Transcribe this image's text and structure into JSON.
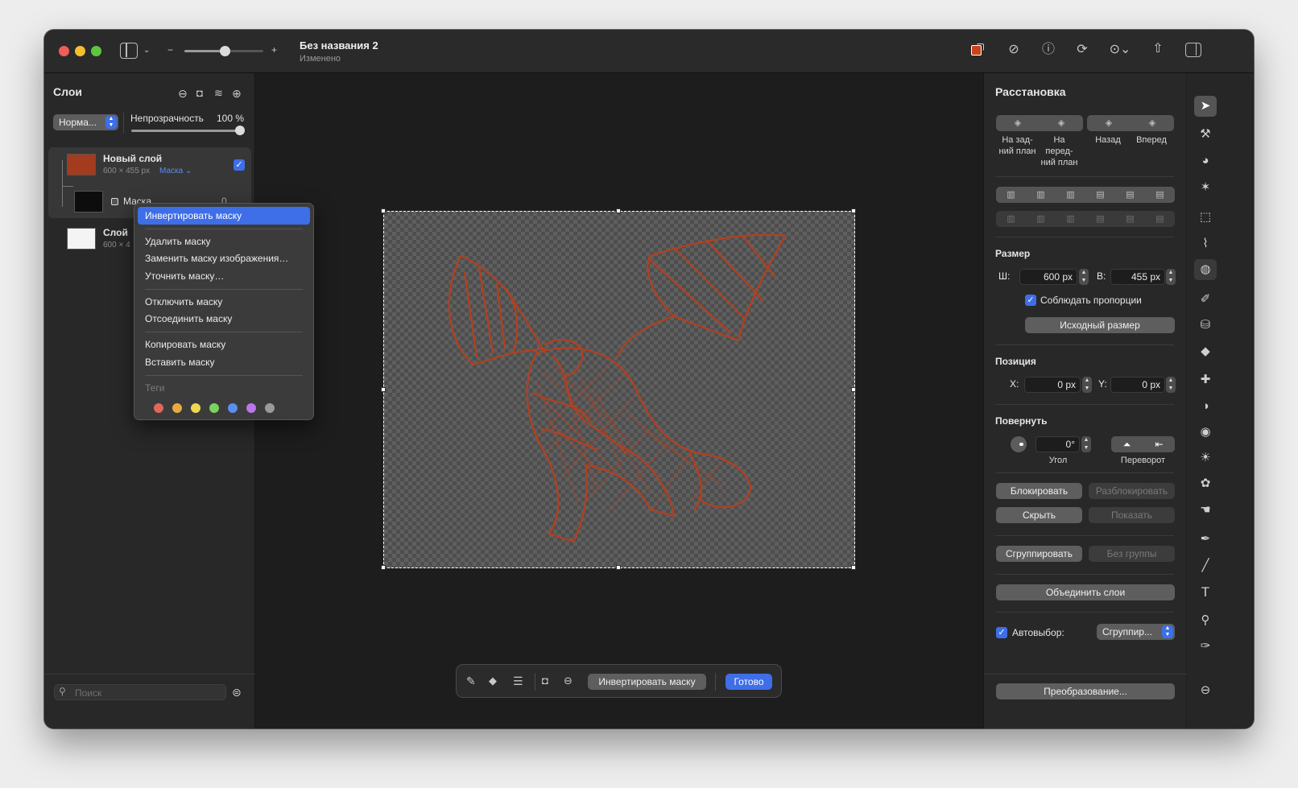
{
  "window": {
    "title": "Без названия 2",
    "subtitle": "Изменено"
  },
  "layers_panel": {
    "title": "Слои",
    "blend_mode": "Норма...",
    "opacity_label": "Непрозрачность",
    "opacity_value": "100 %",
    "opacity_fraction": 1.0,
    "layers": [
      {
        "name": "Новый слой",
        "size": "600 × 455 px",
        "tag": "Маска ⌄",
        "color": "#a33b1e"
      },
      {
        "name": "Маска",
        "extra": "0"
      },
      {
        "name": "Слой",
        "size": "600 × 4"
      }
    ],
    "search_placeholder": "Поиск"
  },
  "context_menu": {
    "items": [
      "Инвертировать маску",
      "Удалить маску",
      "Заменить маску изображения…",
      "Уточнить маску…",
      "Отключить маску",
      "Отсоединить маску",
      "Копировать маску",
      "Вставить маску"
    ],
    "tags_label": "Теги",
    "tag_colors": [
      "#e2665c",
      "#eaa93f",
      "#efd84d",
      "#7ad35c",
      "#5a8ff0",
      "#b877e8",
      "#9a9a9a"
    ]
  },
  "arrange_panel": {
    "title": "Расстановка",
    "order_buttons": [
      "На зад-\nний план",
      "На\nперед-\nний план",
      "Назад",
      "Вперед"
    ],
    "size_title": "Размер",
    "width_label": "Ш:",
    "width_value": "600 px",
    "height_label": "В:",
    "height_value": "455 px",
    "keep_proportions": "Соблюдать пропорции",
    "original_size": "Исходный размер",
    "position_title": "Позиция",
    "x_label": "X:",
    "x_value": "0 px",
    "y_label": "Y:",
    "y_value": "0 px",
    "rotate_title": "Повернуть",
    "angle_value": "0°",
    "angle_label": "Угол",
    "flip_label": "Переворот",
    "lock": "Блокировать",
    "unlock": "Разблокировать",
    "hide": "Скрыть",
    "show": "Показать",
    "group": "Сгруппировать",
    "ungroup": "Без группы",
    "merge": "Объединить слои",
    "autoselect_label": "Автовыбор:",
    "autoselect_value": "Сгруппир...",
    "transform": "Преобразование..."
  },
  "bottom_bar": {
    "invert": "Инвертировать маску",
    "done": "Готово"
  }
}
